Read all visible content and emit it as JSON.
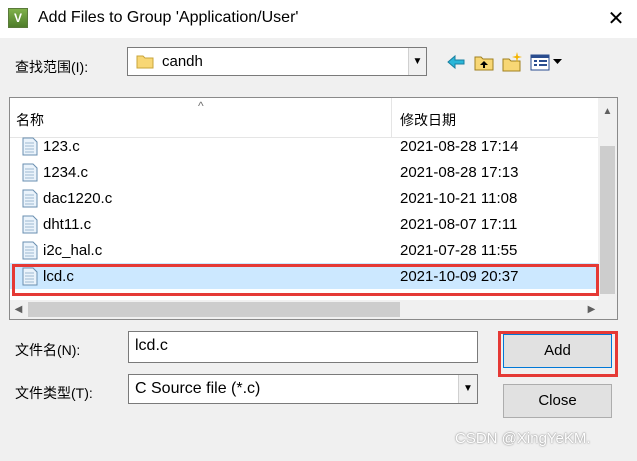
{
  "window": {
    "title": "Add Files to Group 'Application/User'",
    "icon_text": "V",
    "close_glyph": "✕"
  },
  "lookin": {
    "label": "查找范围(I):",
    "value": "candh"
  },
  "toolbar": {
    "icons": [
      "back-icon",
      "up-folder-icon",
      "new-folder-icon",
      "view-menu-icon"
    ]
  },
  "filelist": {
    "columns": [
      "名称",
      "修改日期"
    ],
    "files": [
      {
        "name": "123.c",
        "date": "2021-08-28 17:14"
      },
      {
        "name": "1234.c",
        "date": "2021-08-28 17:13"
      },
      {
        "name": "dac1220.c",
        "date": "2021-10-21 11:08"
      },
      {
        "name": "dht11.c",
        "date": "2021-08-07 17:11"
      },
      {
        "name": "i2c_hal.c",
        "date": "2021-07-28 11:55"
      },
      {
        "name": "lcd.c",
        "date": "2021-10-09 20:37",
        "selected": true
      }
    ]
  },
  "filename": {
    "label": "文件名(N):",
    "value": "lcd.c"
  },
  "filetype": {
    "label": "文件类型(T):",
    "value": "C Source file (*.c)"
  },
  "buttons": {
    "add": "Add",
    "close": "Close"
  },
  "watermark": "CSDN @XingYeKM.",
  "colors": {
    "selection": "#cce8ff",
    "highlight_border": "#e53935",
    "default_button_border": "#0078d7"
  }
}
